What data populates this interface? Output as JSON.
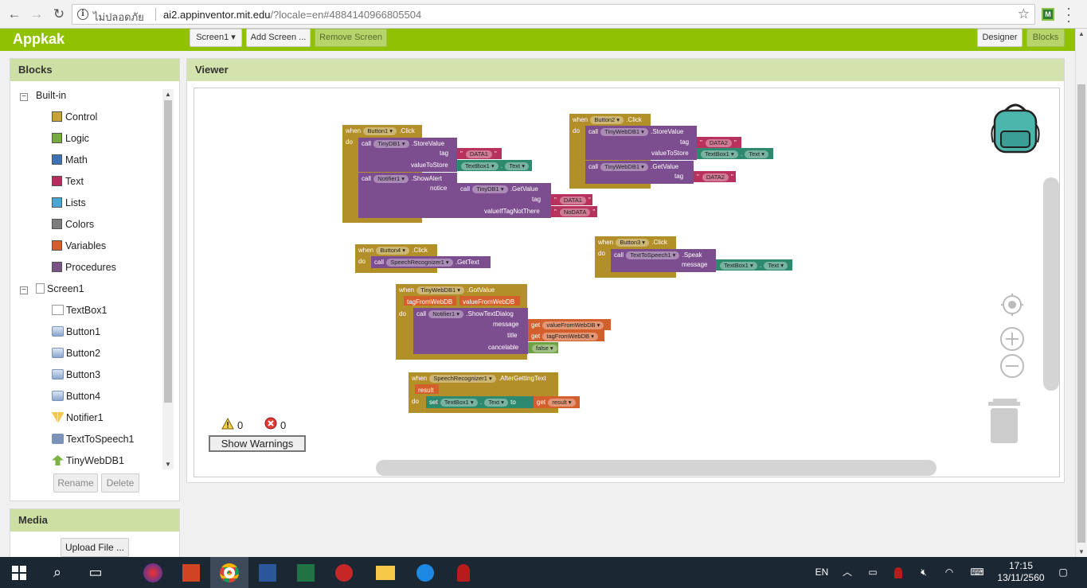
{
  "browser": {
    "security_label": "ไม่ปลอดภัย",
    "url_host": "ai2.appinventor.mit.edu",
    "url_rest": "/?locale=en#4884140966805504",
    "extension_label": "M"
  },
  "header": {
    "app_name": "Appkak",
    "screen_select": "Screen1 ▾",
    "add_screen": "Add Screen ...",
    "remove_screen": "Remove Screen",
    "designer": "Designer",
    "blocks": "Blocks"
  },
  "blocks_panel": {
    "title": "Blocks",
    "builtin_label": "Built-in",
    "builtin": [
      {
        "label": "Control",
        "color": "#c9a13b"
      },
      {
        "label": "Logic",
        "color": "#77ab41"
      },
      {
        "label": "Math",
        "color": "#3f71b5"
      },
      {
        "label": "Text",
        "color": "#b32d5e"
      },
      {
        "label": "Lists",
        "color": "#49a6d4"
      },
      {
        "label": "Colors",
        "color": "#7d7d7d"
      },
      {
        "label": "Variables",
        "color": "#d05f2d"
      },
      {
        "label": "Procedures",
        "color": "#7c5385"
      }
    ],
    "screen_label": "Screen1",
    "components": [
      "TextBox1",
      "Button1",
      "Button2",
      "Button3",
      "Button4",
      "Notifier1",
      "TextToSpeech1",
      "TinyWebDB1"
    ],
    "rename": "Rename",
    "delete": "Delete"
  },
  "media_panel": {
    "title": "Media",
    "upload": "Upload File ..."
  },
  "viewer": {
    "title": "Viewer",
    "warnings_count": "0",
    "errors_count": "0",
    "show_warnings": "Show Warnings"
  },
  "code": {
    "when": "when",
    "do": "do",
    "call": "call",
    "set": "set",
    "get": "get",
    "to": "to",
    "b1": {
      "comp": "Button1",
      "event": ".Click",
      "db": "TinyDB1",
      "store": ".StoreValue",
      "tag": "tag",
      "tag_val": "DATA1",
      "vts": "valueToStore",
      "tb": "TextBox1",
      "prop": "Text",
      "notifier": "Notifier1",
      "alert": ".ShowAlert",
      "notice": "notice",
      "getv": ".GetValue",
      "tag2": "DATA1",
      "vitnt": "valueIfTagNotThere",
      "nodata": "NoDATA"
    },
    "b2": {
      "comp": "Button2",
      "event": ".Click",
      "db": "TinyWebDB1",
      "store": ".StoreValue",
      "tag": "tag",
      "tag_val": "DATA2",
      "vts": "valueToStore",
      "tb": "TextBox1",
      "prop": "Text",
      "getv": ".GetValue",
      "tag2": "DATA2"
    },
    "b4": {
      "comp": "Button4",
      "event": ".Click",
      "sr": "SpeechRecognizer1",
      "gettext": ".GetText"
    },
    "b3": {
      "comp": "Button3",
      "event": ".Click",
      "tts": "TextToSpeech1",
      "speak": ".Speak",
      "message": "message",
      "tb": "TextBox1",
      "prop": "Text"
    },
    "gv": {
      "comp": "TinyWebDB1",
      "event": ".GotValue",
      "p1": "tagFromWebDB",
      "p2": "valueFromWebDB",
      "notifier": "Notifier1",
      "method": ".ShowTextDialog",
      "message": "message",
      "title": "title",
      "cancelable": "cancelable",
      "false": "false"
    },
    "agt": {
      "comp": "SpeechRecognizer1",
      "event": ".AfterGettingText",
      "result": "result",
      "tb": "TextBox1",
      "prop": "Text"
    }
  },
  "taskbar": {
    "lang": "EN",
    "time": "17:15",
    "date": "13/11/2560"
  },
  "colors": {
    "brand_green": "#91c201",
    "panel_header": "#cddfa3",
    "event_block": "#b38f29",
    "procedure_block": "#7d4e8f",
    "text_block": "#b7335e",
    "component_block": "#2e8a6e",
    "variable_block": "#d35f2c"
  }
}
